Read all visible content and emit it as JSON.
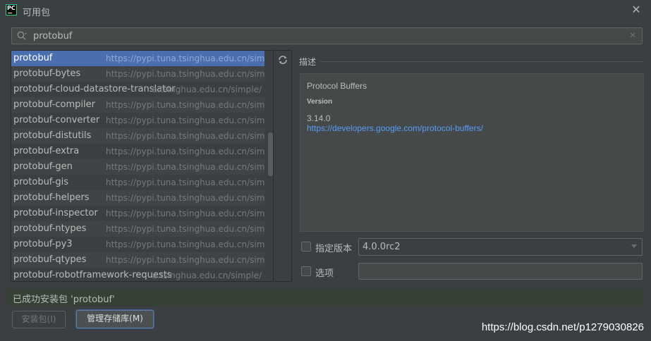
{
  "window": {
    "title": "可用包"
  },
  "search": {
    "value": "protobuf"
  },
  "packages": [
    {
      "name": "protobuf",
      "url": "https://pypi.tuna.tsinghua.edu.cn/simple/"
    },
    {
      "name": "protobuf-bytes",
      "url": "https://pypi.tuna.tsinghua.edu.cn/simple/"
    },
    {
      "name": "protobuf-cloud-datastore-translator",
      "url": "a.tsinghua.edu.cn/simple/"
    },
    {
      "name": "protobuf-compiler",
      "url": "https://pypi.tuna.tsinghua.edu.cn/simple/"
    },
    {
      "name": "protobuf-converter",
      "url": "https://pypi.tuna.tsinghua.edu.cn/simple/"
    },
    {
      "name": "protobuf-distutils",
      "url": "https://pypi.tuna.tsinghua.edu.cn/simple/"
    },
    {
      "name": "protobuf-extra",
      "url": "https://pypi.tuna.tsinghua.edu.cn/simple/"
    },
    {
      "name": "protobuf-gen",
      "url": "https://pypi.tuna.tsinghua.edu.cn/simple/"
    },
    {
      "name": "protobuf-gis",
      "url": "https://pypi.tuna.tsinghua.edu.cn/simple/"
    },
    {
      "name": "protobuf-helpers",
      "url": "https://pypi.tuna.tsinghua.edu.cn/simple/"
    },
    {
      "name": "protobuf-inspector",
      "url": "https://pypi.tuna.tsinghua.edu.cn/simple/"
    },
    {
      "name": "protobuf-ntypes",
      "url": "https://pypi.tuna.tsinghua.edu.cn/simple/"
    },
    {
      "name": "protobuf-py3",
      "url": "https://pypi.tuna.tsinghua.edu.cn/simple/"
    },
    {
      "name": "protobuf-qtypes",
      "url": "https://pypi.tuna.tsinghua.edu.cn/simple/"
    },
    {
      "name": "protobuf-robotframework-requests",
      "url": "a.tsinghua.edu.cn/simple/"
    }
  ],
  "description": {
    "section_label": "描述",
    "title": "Protocol Buffers",
    "version_heading": "Version",
    "version": "3.14.0",
    "link": "https://developers.google.com/protocol-buffers/"
  },
  "options": {
    "specify_version_label": "指定版本",
    "specify_version_value": "4.0.0rc2",
    "options_label": "选项",
    "options_value": ""
  },
  "status": {
    "message": "已成功安装包 'protobuf'"
  },
  "buttons": {
    "install": "安装包(I)",
    "manage": "管理存储库(M)"
  },
  "watermark": "https://blog.csdn.net/p1279030826",
  "icons": {
    "app": "pycharm-icon",
    "close": "close-icon",
    "search": "search-icon",
    "clear": "clear-icon",
    "refresh": "refresh-icon",
    "dropdown": "chevron-down-icon"
  },
  "colors": {
    "selection": "#4b6eaf",
    "link": "#589df6",
    "status_bg": "#344134"
  }
}
